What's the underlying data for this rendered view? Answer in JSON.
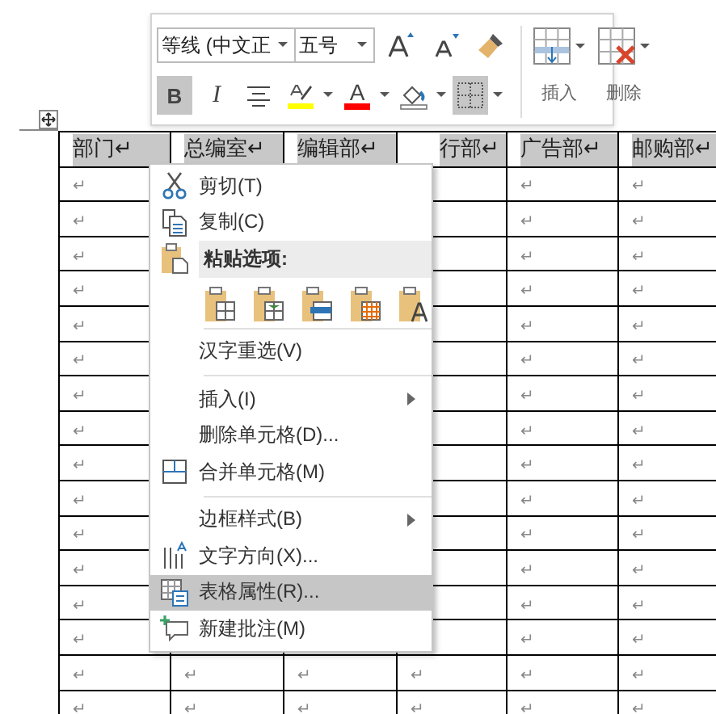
{
  "toolbar": {
    "font": "等线 (中文正",
    "size": "五号",
    "row1": [
      {
        "kind": "grow"
      },
      {
        "kind": "shrink"
      },
      {
        "kind": "painter"
      }
    ],
    "row2": [
      {
        "kind": "bold",
        "label": "B",
        "selected": true,
        "dropdown": false
      },
      {
        "kind": "italic",
        "label": "I",
        "selected": false,
        "dropdown": false
      },
      {
        "kind": "align",
        "selected": false,
        "dropdown": false
      },
      {
        "kind": "highlight",
        "selected": false,
        "dropdown": true
      },
      {
        "kind": "fontcolor",
        "label": "A",
        "selected": false,
        "dropdown": true
      },
      {
        "kind": "shading",
        "selected": false,
        "dropdown": true
      },
      {
        "kind": "borders",
        "selected": true,
        "dropdown": true
      }
    ],
    "actions": [
      {
        "kind": "insert",
        "label": "插入"
      },
      {
        "kind": "delete",
        "label": "删除"
      }
    ]
  },
  "table": {
    "header_selected": true,
    "columns": [
      "部门↵",
      "总编室↵",
      "编辑部↵",
      "行部↵",
      "广告部↵",
      "邮购部↵"
    ],
    "rows": [
      {
        "cells": [
          "↵",
          null,
          null,
          null,
          "↵",
          "↵"
        ]
      },
      {
        "cells": [
          "↵",
          null,
          null,
          null,
          "↵",
          "↵"
        ]
      },
      {
        "cells": [
          "↵",
          null,
          null,
          null,
          "↵",
          "↵"
        ]
      },
      {
        "cells": [
          "↵",
          null,
          null,
          null,
          "↵",
          "↵"
        ]
      },
      {
        "cells": [
          "↵",
          null,
          null,
          null,
          "↵",
          "↵"
        ]
      },
      {
        "cells": [
          "↵",
          null,
          null,
          null,
          "↵",
          "↵"
        ]
      },
      {
        "cells": [
          "↵",
          null,
          null,
          null,
          "↵",
          "↵"
        ]
      },
      {
        "cells": [
          "↵",
          null,
          null,
          null,
          "↵",
          "↵"
        ]
      },
      {
        "cells": [
          "↵",
          null,
          null,
          null,
          "↵",
          "↵"
        ]
      },
      {
        "cells": [
          "↵",
          null,
          null,
          null,
          "↵",
          "↵"
        ]
      },
      {
        "cells": [
          "↵",
          null,
          null,
          null,
          "↵",
          "↵"
        ]
      },
      {
        "cells": [
          "↵",
          null,
          null,
          null,
          "↵",
          "↵"
        ]
      },
      {
        "cells": [
          "↵",
          null,
          null,
          null,
          "↵",
          "↵"
        ]
      },
      {
        "cells": [
          "↵",
          null,
          null,
          null,
          "↵",
          "↵"
        ]
      },
      {
        "cells": [
          "↵",
          "↵",
          "↵",
          "↵",
          "↵",
          "↵"
        ]
      },
      {
        "cells": [
          "↵",
          "↵",
          "↵",
          "↵",
          "↵",
          "↵"
        ]
      }
    ]
  },
  "menu": [
    {
      "kind": "item",
      "label": "剪切(T)",
      "selected": false,
      "submenu": false
    },
    {
      "kind": "item",
      "label": "复制(C)",
      "selected": false,
      "submenu": false
    },
    {
      "kind": "header",
      "label": "粘贴选项:"
    },
    {
      "kind": "paste"
    },
    {
      "kind": "separator"
    },
    {
      "kind": "item",
      "label": "汉字重选(V)",
      "selected": false,
      "submenu": false
    },
    {
      "kind": "separator"
    },
    {
      "kind": "item",
      "label": "插入(I)",
      "selected": false,
      "submenu": true
    },
    {
      "kind": "item",
      "label": "删除单元格(D)...",
      "selected": false,
      "submenu": false
    },
    {
      "kind": "item",
      "label": "合并单元格(M)",
      "selected": false,
      "submenu": false
    },
    {
      "kind": "separator"
    },
    {
      "kind": "item",
      "label": "边框样式(B)",
      "selected": false,
      "submenu": true
    },
    {
      "kind": "item",
      "label": "文字方向(X)...",
      "selected": false,
      "submenu": false
    },
    {
      "kind": "item",
      "label": "表格属性(R)...",
      "selected": true,
      "submenu": false
    },
    {
      "kind": "item",
      "label": "新建批注(M)",
      "selected": false,
      "submenu": false
    }
  ]
}
